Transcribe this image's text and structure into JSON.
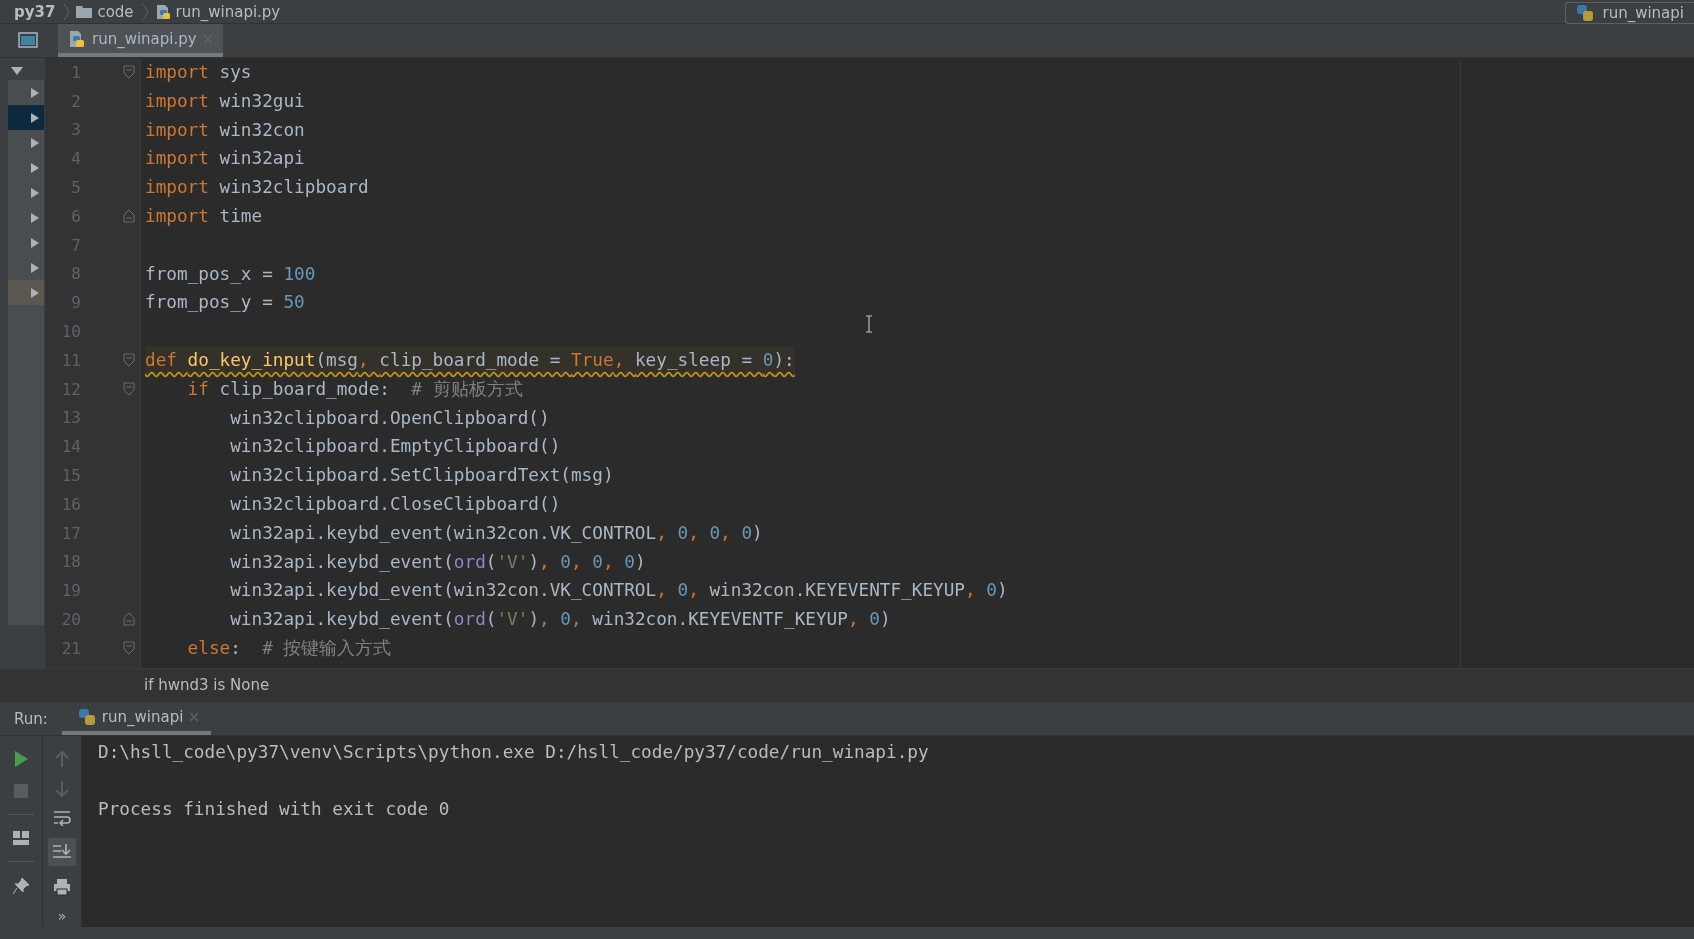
{
  "breadcrumb": [
    {
      "kind": "module",
      "label": "py37"
    },
    {
      "kind": "folder",
      "label": "code"
    },
    {
      "kind": "file",
      "label": "run_winapi.py"
    }
  ],
  "run_config": {
    "label": "run_winapi"
  },
  "editor_tabs": [
    {
      "label": "run_winapi.py",
      "selected": true
    }
  ],
  "lines": [
    {
      "number": "1",
      "fold_start": true,
      "fold_end": false,
      "warning": false,
      "tokens": [
        {
          "kind": "kw",
          "text": "import"
        },
        {
          "kind": "plain",
          "text": " sys"
        }
      ]
    },
    {
      "number": "2",
      "fold_start": false,
      "fold_end": false,
      "warning": false,
      "tokens": [
        {
          "kind": "kw",
          "text": "import"
        },
        {
          "kind": "plain",
          "text": " win32gui"
        }
      ]
    },
    {
      "number": "3",
      "fold_start": false,
      "fold_end": false,
      "warning": false,
      "tokens": [
        {
          "kind": "kw",
          "text": "import"
        },
        {
          "kind": "plain",
          "text": " win32con"
        }
      ]
    },
    {
      "number": "4",
      "fold_start": false,
      "fold_end": false,
      "warning": false,
      "tokens": [
        {
          "kind": "kw",
          "text": "import"
        },
        {
          "kind": "plain",
          "text": " win32api"
        }
      ]
    },
    {
      "number": "5",
      "fold_start": false,
      "fold_end": false,
      "warning": false,
      "tokens": [
        {
          "kind": "kw",
          "text": "import"
        },
        {
          "kind": "plain",
          "text": " win32clipboard"
        }
      ]
    },
    {
      "number": "6",
      "fold_start": false,
      "fold_end": true,
      "warning": false,
      "tokens": [
        {
          "kind": "kw",
          "text": "import"
        },
        {
          "kind": "plain",
          "text": " time"
        }
      ]
    },
    {
      "number": "7",
      "fold_start": false,
      "fold_end": false
    },
    {
      "number": "8",
      "fold_start": false,
      "fold_end": false,
      "warning": false,
      "tokens": [
        {
          "kind": "plain",
          "text": "from_pos_x = "
        },
        {
          "kind": "num",
          "text": "100"
        }
      ]
    },
    {
      "number": "9",
      "fold_start": false,
      "fold_end": false,
      "warning": false,
      "tokens": [
        {
          "kind": "plain",
          "text": "from_pos_y = "
        },
        {
          "kind": "num",
          "text": "50"
        }
      ]
    },
    {
      "number": "10",
      "fold_start": false,
      "fold_end": false
    },
    {
      "number": "11",
      "fold_start": true,
      "fold_end": false,
      "warning": true,
      "tokens": [
        {
          "kind": "kw",
          "text": "def "
        },
        {
          "kind": "fn",
          "text": "do_key_input"
        },
        {
          "kind": "plain",
          "text": "(msg"
        },
        {
          "kind": "kw",
          "text": ", "
        },
        {
          "kind": "plain",
          "text": "clip_board_mode = "
        },
        {
          "kind": "kw",
          "text": "True"
        },
        {
          "kind": "kw",
          "text": ", "
        },
        {
          "kind": "plain",
          "text": "key_sleep = "
        },
        {
          "kind": "num",
          "text": "0"
        },
        {
          "kind": "plain",
          "text": "):"
        }
      ]
    },
    {
      "number": "12",
      "fold_start": true,
      "fold_end": false,
      "warning": false,
      "tokens": [
        {
          "kind": "kw",
          "text": "    if"
        },
        {
          "kind": "plain",
          "text": " clip_board_mode:  "
        },
        {
          "kind": "com",
          "text": "# 剪贴板方式"
        }
      ]
    },
    {
      "number": "13",
      "fold_start": false,
      "fold_end": false,
      "warning": false,
      "tokens": [
        {
          "kind": "plain",
          "text": "        win32clipboard.OpenClipboard()"
        }
      ]
    },
    {
      "number": "14",
      "fold_start": false,
      "fold_end": false,
      "warning": false,
      "tokens": [
        {
          "kind": "plain",
          "text": "        win32clipboard.EmptyClipboard()"
        }
      ]
    },
    {
      "number": "15",
      "fold_start": false,
      "fold_end": false,
      "warning": false,
      "tokens": [
        {
          "kind": "plain",
          "text": "        win32clipboard.SetClipboardText(msg)"
        }
      ]
    },
    {
      "number": "16",
      "fold_start": false,
      "fold_end": false,
      "warning": false,
      "tokens": [
        {
          "kind": "plain",
          "text": "        win32clipboard.CloseClipboard()"
        }
      ]
    },
    {
      "number": "17",
      "fold_start": false,
      "fold_end": false,
      "warning": false,
      "tokens": [
        {
          "kind": "plain",
          "text": "        win32api.keybd_event(win32con.VK_CONTROL"
        },
        {
          "kind": "kw",
          "text": ", "
        },
        {
          "kind": "num",
          "text": "0"
        },
        {
          "kind": "kw",
          "text": ", "
        },
        {
          "kind": "num",
          "text": "0"
        },
        {
          "kind": "kw",
          "text": ", "
        },
        {
          "kind": "num",
          "text": "0"
        },
        {
          "kind": "plain",
          "text": ")"
        }
      ]
    },
    {
      "number": "18",
      "fold_start": false,
      "fold_end": false,
      "warning": false,
      "tokens": [
        {
          "kind": "plain",
          "text": "        win32api.keybd_event("
        },
        {
          "kind": "builtin",
          "text": "ord"
        },
        {
          "kind": "plain",
          "text": "("
        },
        {
          "kind": "str",
          "text": "'V'"
        },
        {
          "kind": "plain",
          "text": ")"
        },
        {
          "kind": "kw",
          "text": ", "
        },
        {
          "kind": "num",
          "text": "0"
        },
        {
          "kind": "kw",
          "text": ", "
        },
        {
          "kind": "num",
          "text": "0"
        },
        {
          "kind": "kw",
          "text": ", "
        },
        {
          "kind": "num",
          "text": "0"
        },
        {
          "kind": "plain",
          "text": ")"
        }
      ]
    },
    {
      "number": "19",
      "fold_start": false,
      "fold_end": false,
      "warning": false,
      "tokens": [
        {
          "kind": "plain",
          "text": "        win32api.keybd_event(win32con.VK_CONTROL"
        },
        {
          "kind": "kw",
          "text": ", "
        },
        {
          "kind": "num",
          "text": "0"
        },
        {
          "kind": "kw",
          "text": ", "
        },
        {
          "kind": "plain",
          "text": "win32con.KEYEVENTF_KEYUP"
        },
        {
          "kind": "kw",
          "text": ", "
        },
        {
          "kind": "num",
          "text": "0"
        },
        {
          "kind": "plain",
          "text": ")"
        }
      ]
    },
    {
      "number": "20",
      "fold_start": false,
      "fold_end": true,
      "warning": false,
      "tokens": [
        {
          "kind": "plain",
          "text": "        win32api.keybd_event("
        },
        {
          "kind": "builtin",
          "text": "ord"
        },
        {
          "kind": "plain",
          "text": "("
        },
        {
          "kind": "str",
          "text": "'V'"
        },
        {
          "kind": "plain",
          "text": ")"
        },
        {
          "kind": "kw",
          "text": ", "
        },
        {
          "kind": "num",
          "text": "0"
        },
        {
          "kind": "kw",
          "text": ", "
        },
        {
          "kind": "plain",
          "text": "win32con.KEYEVENTF_KEYUP"
        },
        {
          "kind": "kw",
          "text": ", "
        },
        {
          "kind": "num",
          "text": "0"
        },
        {
          "kind": "plain",
          "text": ")"
        }
      ]
    },
    {
      "number": "21",
      "fold_start": true,
      "fold_end": false,
      "warning": false,
      "tokens": [
        {
          "kind": "kw",
          "text": "    else"
        },
        {
          "kind": "plain",
          "text": ":  "
        },
        {
          "kind": "com",
          "text": "# 按键输入方式"
        }
      ]
    }
  ],
  "editor_breadcrumb": "if hwnd3 is None",
  "run_panel": {
    "label": "Run:",
    "tabs": [
      {
        "label": "run_winapi",
        "selected": true
      }
    ],
    "output": [
      "D:\\hsll_code\\py37\\venv\\Scripts\\python.exe D:/hsll_code/py37/code/run_winapi.py",
      "Process finished with exit code 0"
    ],
    "more_label": "»"
  }
}
